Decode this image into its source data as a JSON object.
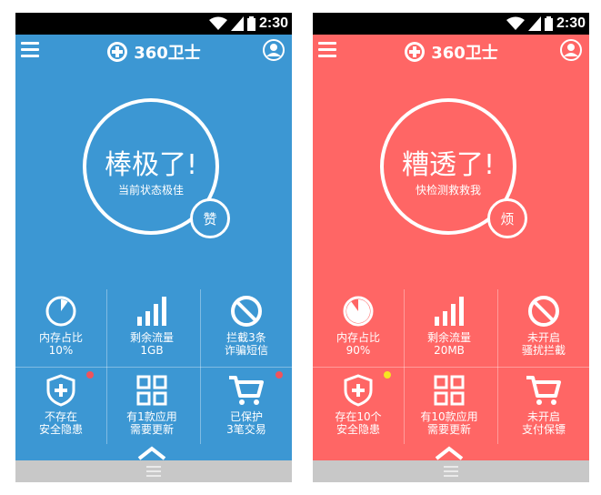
{
  "status_bar": {
    "time": "2:30"
  },
  "header": {
    "title": "360卫士"
  },
  "colors": {
    "accent_left": "#3c97d3",
    "accent_right": "#ff6665",
    "alert_red": "#f0535c",
    "alert_yellow": "#f6e421"
  },
  "icons": [
    "wifi-icon",
    "signal-icon",
    "battery-icon",
    "menu-icon",
    "logo-icon",
    "user-icon",
    "pie-icon",
    "bars-icon",
    "block-icon",
    "shield-icon",
    "grid-icon",
    "cart-icon",
    "chevron-up-icon",
    "handle-icon"
  ],
  "left": {
    "score_text": "棒极了!",
    "score_sub": "当前状态极佳",
    "badge": "赞",
    "memory_fraction": 0.1,
    "tiles": [
      {
        "line1": "内存占比",
        "line2": "10%"
      },
      {
        "line1": "剩余流量",
        "line2": "1GB"
      },
      {
        "line1": "拦截3条",
        "line2": "诈骗短信"
      },
      {
        "line1": "不存在",
        "line2": "安全隐患"
      },
      {
        "line1": "有1款应用",
        "line2": "需要更新"
      },
      {
        "line1": "已保护",
        "line2": "3笔交易"
      }
    ]
  },
  "right": {
    "score_text": "糟透了!",
    "score_sub": "快检测救救我",
    "badge": "烦",
    "memory_fraction": 0.9,
    "tiles": [
      {
        "line1": "内存占比",
        "line2": "90%"
      },
      {
        "line1": "剩余流量",
        "line2": "20MB"
      },
      {
        "line1": "未开启",
        "line2": "骚扰拦截"
      },
      {
        "line1": "存在10个",
        "line2": "安全隐患"
      },
      {
        "line1": "有10款应用",
        "line2": "需要更新"
      },
      {
        "line1": "未开启",
        "line2": "支付保镖"
      }
    ]
  }
}
